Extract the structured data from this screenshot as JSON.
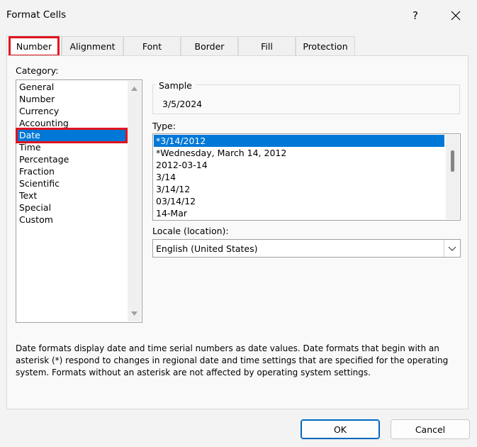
{
  "window": {
    "title": "Format Cells",
    "help_label": "?"
  },
  "tabs": [
    {
      "label": "Number"
    },
    {
      "label": "Alignment"
    },
    {
      "label": "Font"
    },
    {
      "label": "Border"
    },
    {
      "label": "Fill"
    },
    {
      "label": "Protection"
    }
  ],
  "category": {
    "label": "Category:",
    "items": [
      "General",
      "Number",
      "Currency",
      "Accounting",
      "Date",
      "Time",
      "Percentage",
      "Fraction",
      "Scientific",
      "Text",
      "Special",
      "Custom"
    ],
    "selected": "Date"
  },
  "sample": {
    "label": "Sample",
    "value": "3/5/2024"
  },
  "type": {
    "label": "Type:",
    "items": [
      "*3/14/2012",
      "*Wednesday, March 14, 2012",
      "2012-03-14",
      "3/14",
      "3/14/12",
      "03/14/12",
      "14-Mar"
    ],
    "selected": "*3/14/2012"
  },
  "locale": {
    "label": "Locale (location):",
    "value": "English (United States)"
  },
  "description": "Date formats display date and time serial numbers as date values.  Date formats that begin with an asterisk (*) respond to changes in regional date and time settings that are specified for the operating system. Formats without an asterisk are not affected by operating system settings.",
  "buttons": {
    "ok": "OK",
    "cancel": "Cancel"
  },
  "colors": {
    "selection": "#0078d7",
    "highlight_outline": "#e0131f"
  }
}
